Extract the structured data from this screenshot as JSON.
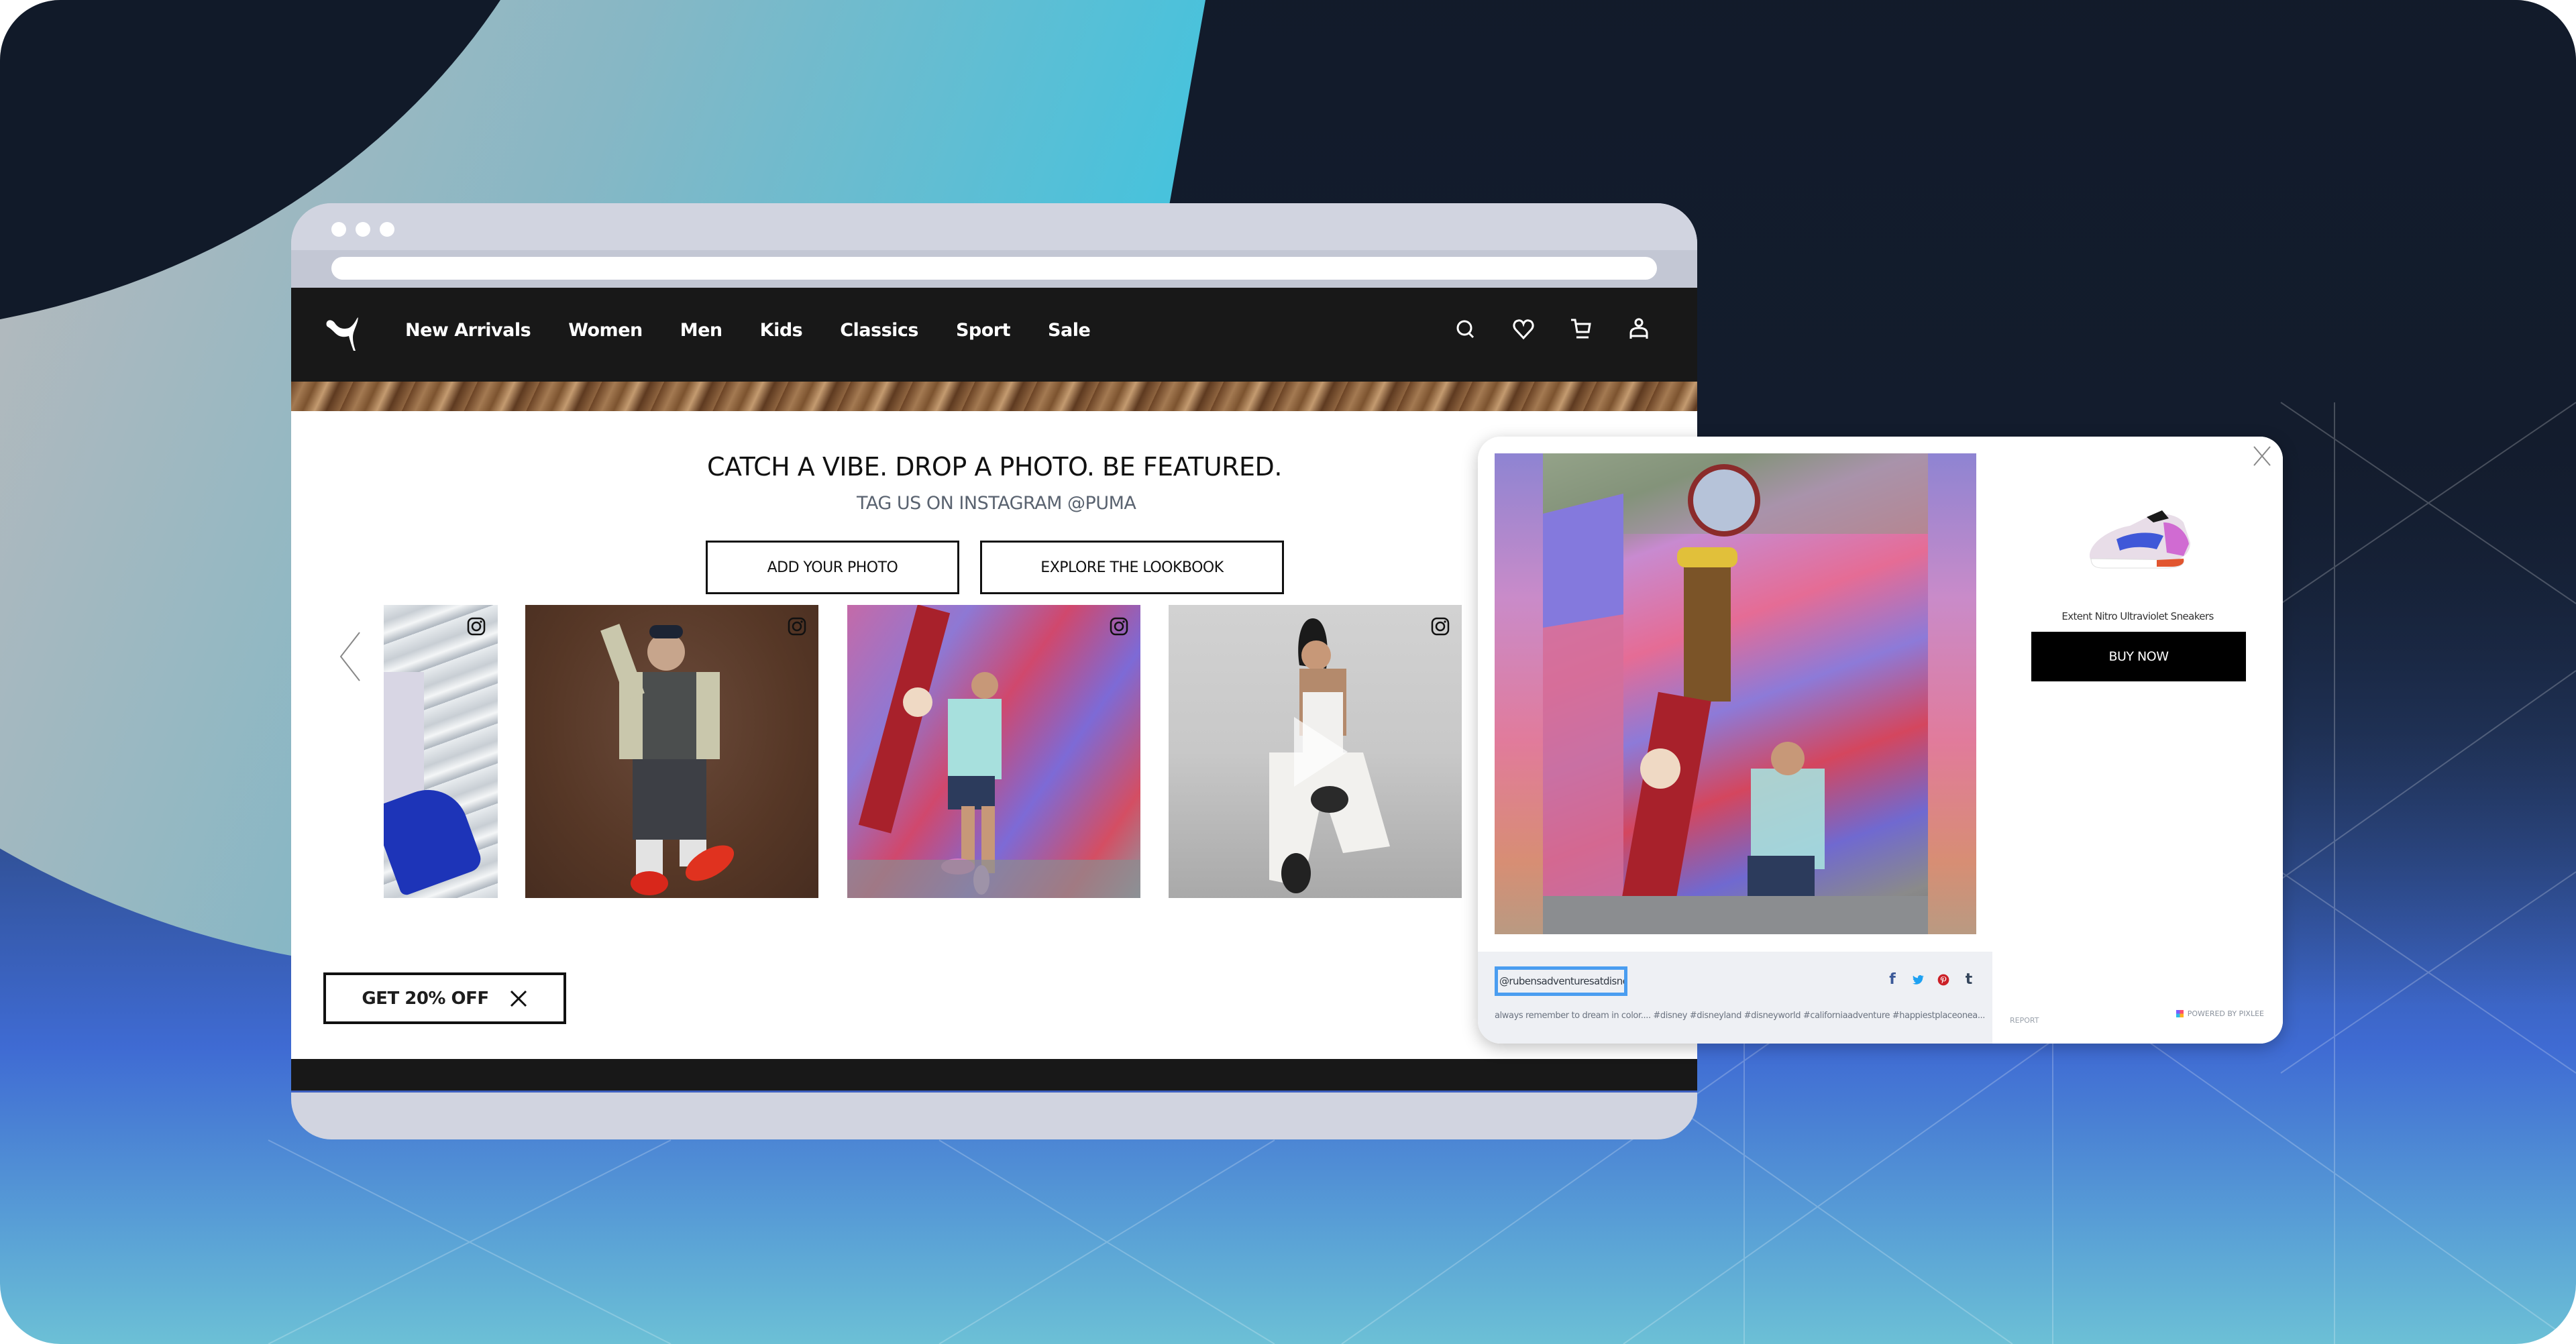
{
  "colors": {
    "nav_bg": "#181818",
    "browser_chrome": "#d1d4e0",
    "handle_highlight": "#4a9df0",
    "facebook": "#3b5998",
    "twitter": "#1da1f2",
    "pinterest": "#cb2027",
    "tumblr": "#35465c"
  },
  "nav": {
    "logo_icon": "puma-logo-icon",
    "links": [
      "New Arrivals",
      "Women",
      "Men",
      "Kids",
      "Classics",
      "Sport",
      "Sale"
    ],
    "icons": [
      "search-icon",
      "heart-icon",
      "cart-icon",
      "user-icon"
    ]
  },
  "hero": {
    "headline": "CATCH A VIBE. DROP A PHOTO. BE FEATURED.",
    "subheadline": "TAG US ON INSTAGRAM @PUMA",
    "add_photo_label": "ADD YOUR PHOTO",
    "explore_label": "EXPLORE THE LOOKBOOK"
  },
  "gallery": {
    "prev_icon": "chevron-left-icon",
    "tiles": [
      {
        "source_icon": "instagram-icon",
        "subject": "blue suede sneaker against metal shutter"
      },
      {
        "source_icon": "instagram-icon",
        "subject": "man in cardigan with red sneakers"
      },
      {
        "source_icon": "instagram-icon",
        "subject": "man at colorful mural"
      },
      {
        "source_icon": "instagram-icon",
        "subject": "woman in white outfit",
        "video": true
      }
    ]
  },
  "promo": {
    "label": "GET 20% OFF",
    "close_icon": "close-icon"
  },
  "lightbox": {
    "handle": "@rubensadventuresatdisney",
    "caption": "always remember to dream in color.... #disney #disneyland #disneyworld #californiaadventure #happiestplaceonea...",
    "share": [
      {
        "name": "facebook",
        "glyph": "f"
      },
      {
        "name": "twitter",
        "glyph": "🐦"
      },
      {
        "name": "pinterest",
        "glyph": "P"
      },
      {
        "name": "tumblr",
        "glyph": "t"
      }
    ],
    "product_name": "Extent Nitro Ultraviolet Sneakers",
    "buy_label": "BUY NOW",
    "report_label": "REPORT",
    "powered_by": "POWERED BY PIXLEE"
  }
}
